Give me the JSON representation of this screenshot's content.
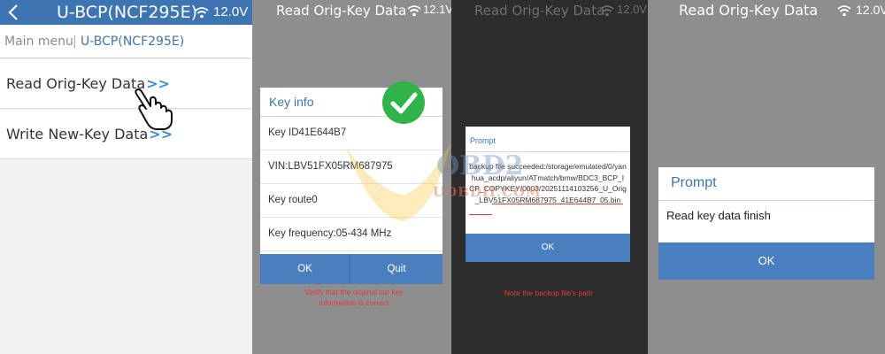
{
  "panels": {
    "menu": {
      "header_title": "U-BCP(NCF295E)",
      "voltage": "12.0V",
      "breadcrumb": [
        "Main menu",
        "U-BCP(NCF295E)"
      ],
      "items": [
        {
          "label": "Read Orig-Key Data",
          "arrow": ">>"
        },
        {
          "label": "Write New-Key Data",
          "arrow": ">>"
        }
      ]
    },
    "key_info": {
      "status_title": "Read Orig-Key Data",
      "voltage": "12.1V",
      "dialog_title": "Key info",
      "rows": [
        "Key ID41E644B7",
        "VIN:LBV51FX05RM687975",
        "Key route0",
        "Key frequency:05-434 MHz"
      ],
      "ok_label": "OK",
      "quit_label": "Quit",
      "note": "Verify that the original car key information is correct"
    },
    "backup": {
      "status_title": "Read Orig-Key Data",
      "voltage": "12.0V",
      "dialog_title": "Prompt",
      "message": "backup file succeeded:/storage/emulated/0/yanhua_acdp/aliyun/ATmatch/bmw/BDC3_BCP_ICP_COPYKEY/0003/20251114103256_U_Orig_LBV51FX05RM687975_41E644B7_05.bin",
      "ok_label": "OK",
      "note": "Note the backup file's path"
    },
    "finish": {
      "status_title": "Read Orig-Key Data",
      "voltage": "12.0V",
      "dialog_title": "Prompt",
      "message": "Read key data finish",
      "ok_label": "OK"
    }
  },
  "watermark": {
    "line1": "OBD2",
    "line2": "UOBDII.COM"
  },
  "colors": {
    "accent": "#3c75b2",
    "button": "#4a7fbf",
    "check": "#2fb44a",
    "note": "#e53935",
    "link_arrow": "#3c8fd6"
  }
}
